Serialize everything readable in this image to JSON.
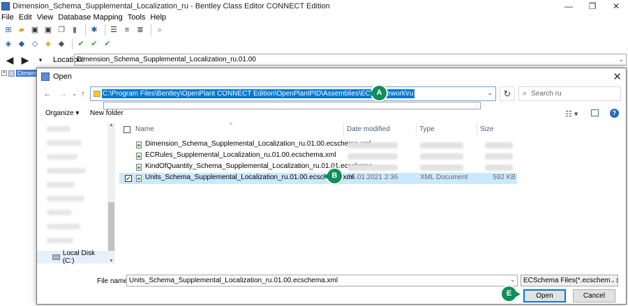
{
  "app": {
    "title": "Dimension_Schema_Supplemental_Localization_ru - Bentley Class Editor CONNECT Edition",
    "window_controls": [
      "—",
      "❐",
      "✕"
    ]
  },
  "menu": [
    "File",
    "Edit",
    "View",
    "Database Mapping",
    "Tools",
    "Help"
  ],
  "location": {
    "label": "Location:",
    "value": "Dimension_Schema_Supplemental_Localization_ru.01.00"
  },
  "tree": {
    "node_label": "Dimensio"
  },
  "dialog": {
    "title": "Open",
    "address_path": "C:\\Program Files\\Bentley\\OpenPlant CONNECT Edition\\OpenPlantPID\\Assemblies\\ECFramework\\ru",
    "search_placeholder": "Search ru",
    "organize_label": "Organize ▾",
    "new_folder_label": "New folder",
    "nav_selected_label": "Local Disk (C:)",
    "columns": {
      "name": "Name",
      "date_modified": "Date modified",
      "type": "Type",
      "size": "Size"
    },
    "files": [
      {
        "name": "Dimension_Schema_Supplemental_Localization_ru.01.00.ecschema.xml",
        "date": "",
        "type": "",
        "size": "",
        "selected": false
      },
      {
        "name": "ECRules_Supplemental_Localization_ru.01.00.ecschema.xml",
        "date": "",
        "type": "",
        "size": "",
        "selected": false
      },
      {
        "name": "KindOfQuantity_Schema_Supplemental_Localization_ru.01.01.ecschema...",
        "date": "",
        "type": "",
        "size": "",
        "selected": false
      },
      {
        "name": "Units_Schema_Supplemental_Localization_ru.01.00.ecschema.xml",
        "date": "26.01.2021 2:36",
        "type": "XML Document",
        "size": "592 KB",
        "selected": true
      }
    ],
    "file_name_label": "File name:",
    "file_name_value": "Units_Schema_Supplemental_Localization_ru.01.00.ecschema.xml",
    "file_type_value": "ECSchema Files(*.ecschema.xml",
    "open_label": "Open",
    "cancel_label": "Cancel",
    "check_mark": "✓"
  },
  "callouts": {
    "a": "A",
    "b": "B",
    "e": "E"
  },
  "colors": {
    "callout": "#0f8f5a",
    "selection": "#0078d7",
    "row_selected": "#cce8ff"
  }
}
